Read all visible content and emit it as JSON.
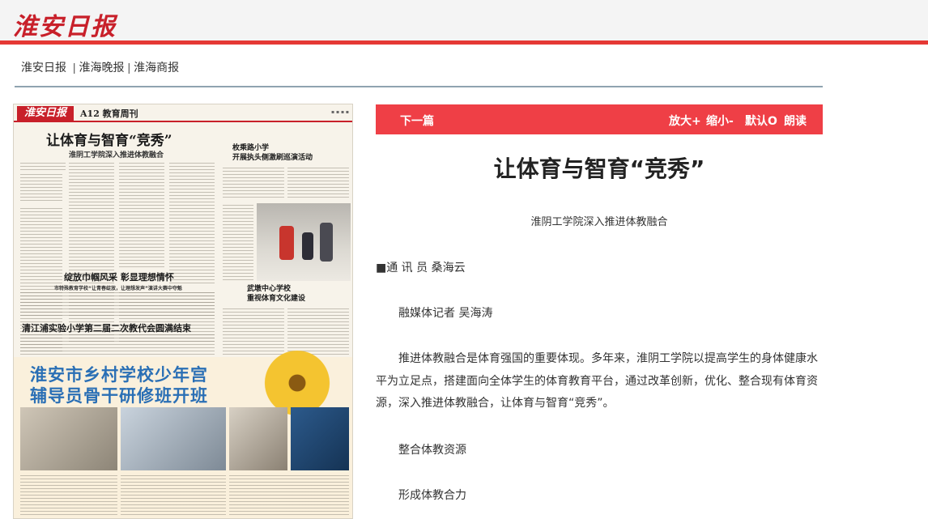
{
  "masthead": {
    "logo": "淮安日报",
    "accent_color": "#e53935"
  },
  "nav": {
    "link1": "淮安日报",
    "sep1": "|",
    "link2": "淮海晚报",
    "sep2": "|",
    "link3": "淮海商报"
  },
  "paper": {
    "logo": "淮安日报",
    "section": "A12 教育周刊",
    "lead_title": "让体育与智育“竞秀”",
    "lead_sub": "淮阴工学院深入推进体教融合",
    "col2_title": "枚乘路小学\n开展执头侧激刷巡演活动",
    "mid_title1": "绽放巾帼风采  彰显理想情怀",
    "mid_sub1": "市特殊教育学校“让青春绽放，让理想发声”演讲大赛中夺魁",
    "mid_title2": "清江浦实验小学第二届二次教代会圆满结束",
    "right_title": "武墩中心学校\n重视体育文化建设",
    "banner_line1": "淮安市乡村学校少年宫",
    "banner_line2": "辅导员骨干研修班开班"
  },
  "toolbar": {
    "prev": "下一篇",
    "zoom_in": "放大+",
    "zoom_out": "缩小-",
    "default": "默认O",
    "read": "朗读"
  },
  "article": {
    "title": "让体育与智育“竞秀”",
    "subtitle": "淮阴工学院深入推进体教融合",
    "author1": "■通 讯 员 桑海云",
    "author2": "融媒体记者 吴海涛",
    "body": "推进体教融合是体育强国的重要体现。多年来，淮阴工学院以提高学生的身体健康水平为立足点，搭建面向全体学生的体育教育平台，通过改革创新，优化、整合现有体育资源，深入推进体教融合，让体育与智育“竞秀”。",
    "h1": "整合体教资源",
    "h2": "形成体教合力"
  }
}
